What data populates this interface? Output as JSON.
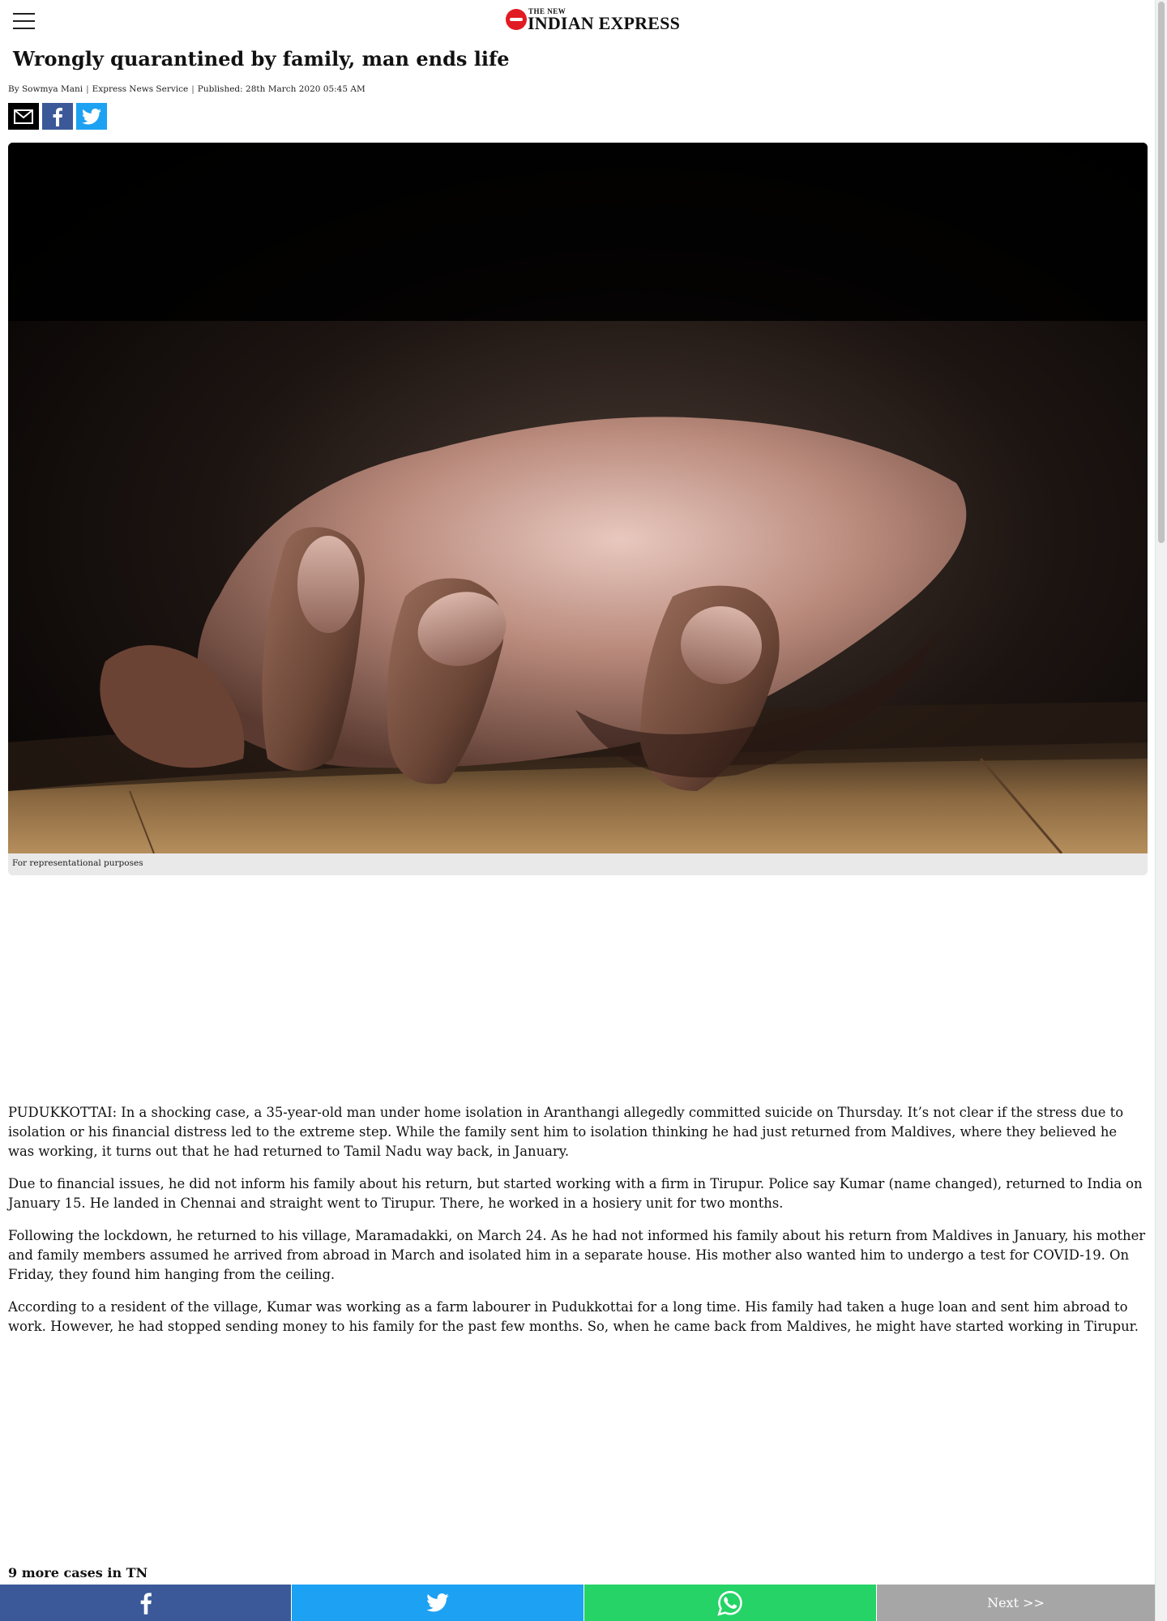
{
  "header": {
    "menu_icon": "hamburger-menu-icon",
    "logo_small": "THE NEW",
    "logo_big": "INDIAN EXPRESS"
  },
  "article": {
    "headline": "Wrongly quarantined by family, man ends life",
    "author": "By Sowmya Mani",
    "service": "Express News Service",
    "published": "Published: 28th March 2020 05:45 AM",
    "image_caption": "For representational purposes",
    "paragraphs": [
      "PUDUKKOTTAI: In a shocking case, a 35-year-old man under home isolation in Aranthangi allegedly committed suicide on Thursday. It’s not clear if the stress due to isolation or his financial distress led to the extreme step. While the family sent him to isolation thinking he had just returned from Maldives, where they believed he was working, it turns out that he had returned to Tamil Nadu way back, in January.",
      "Due to financial issues, he did not inform his family about his return, but started working with a firm in Tirupur. Police say Kumar (name changed), returned to India on January 15. He landed in Chennai and straight went to Tirupur. There, he worked in a hosiery unit for two months.",
      "Following the lockdown, he returned to his village, Maramadakki, on March 24. As he had not informed his family about his return from Maldives in January, his mother and family members assumed he arrived from abroad in March and isolated him in a separate house. His mother also wanted him to undergo a test for COVID-19. On Friday, they found him hanging from the ceiling.",
      "According to a resident of the village, Kumar was working as a farm labourer in Pudukkottai for a long time. His family had taken a huge loan and sent him abroad to work. However, he had stopped sending money to his family for the past few months. So, when he came back from Maldives, he might have started working in Tirupur."
    ],
    "subheading": "9 more cases in TN"
  },
  "share": {
    "icons": [
      "email-icon",
      "facebook-icon",
      "twitter-icon"
    ]
  },
  "bottom_bar": {
    "icons": [
      "facebook-icon",
      "twitter-icon",
      "whatsapp-icon"
    ],
    "next_label": "Next >>"
  },
  "colors": {
    "facebook": "#3b5998",
    "twitter": "#1da1f2",
    "whatsapp": "#25d366",
    "next": "#a6a6a6",
    "logo_red": "#e11b22"
  }
}
